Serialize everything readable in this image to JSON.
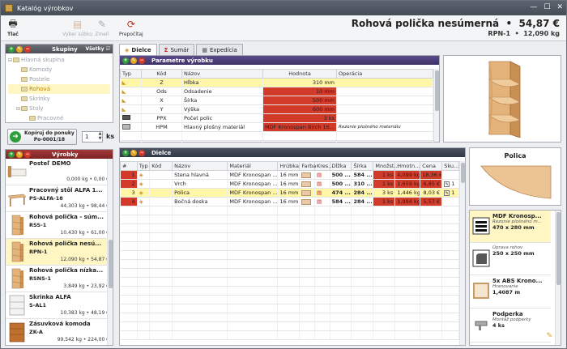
{
  "window": {
    "title": "Katalóg výrobkov"
  },
  "toolbar": {
    "print": "Tlač",
    "choose": "Výber súbku",
    "edit": "Zmeň",
    "recalc": "Prepočítaj"
  },
  "product": {
    "title": "Rohová polička nesúmerná",
    "price": "54,87 €",
    "code": "RPN-1",
    "weight": "12,090 kg"
  },
  "groups": {
    "header": "Skupiny",
    "all_label": "Všetky",
    "items": [
      {
        "label": "Hlavná skupina",
        "level": 0
      },
      {
        "label": "Komody",
        "level": 1
      },
      {
        "label": "Postele",
        "level": 1
      },
      {
        "label": "Rohová",
        "level": 1,
        "selected": true
      },
      {
        "label": "Skrinky",
        "level": 1
      },
      {
        "label": "Stoly",
        "level": 1
      },
      {
        "label": "Pracovné",
        "level": 2
      }
    ]
  },
  "copy": {
    "button_line1": "Kopíruj do ponuky",
    "button_line2": "Po-0001/18",
    "qty": "1",
    "unit": "ks"
  },
  "products": {
    "header": "Výrobky",
    "items": [
      {
        "name": "Posteľ DEMO",
        "code": "",
        "info": "0,000 kg • 0,00 €"
      },
      {
        "name": "Pracovný stôl ALFA 1...",
        "code": "PS-ALFA-18",
        "info": "44,303 kg • 98,44 €"
      },
      {
        "name": "Rohová polička - súm...",
        "code": "RSS-1",
        "info": "10,430 kg • 61,00 €"
      },
      {
        "name": "Rohová polička nesú...",
        "code": "RPN-1",
        "info": "12,090 kg • 54,87 €",
        "selected": true
      },
      {
        "name": "Rohová polička nízka...",
        "code": "RSNS-1",
        "info": "3,849 kg • 23,92 €"
      },
      {
        "name": "Skrinka ALFA",
        "code": "S-AL1",
        "info": "10,383 kg • 48,19 €"
      },
      {
        "name": "Zásuvková komoda",
        "code": "ZK-A",
        "info": "99,542 kg • 224,00 €"
      }
    ]
  },
  "tabs": [
    {
      "label": "Dielce",
      "active": true
    },
    {
      "label": "Sumár"
    },
    {
      "label": "Expedícia"
    }
  ],
  "params": {
    "header": "Parametre výrobku",
    "columns": [
      "Typ",
      "Kód",
      "Názov",
      "Hodnota",
      "Operácia"
    ],
    "rows": [
      {
        "code": "Z",
        "name": "Hĺbka",
        "value": "310 mm",
        "op": "",
        "hl": true
      },
      {
        "code": "Ods",
        "name": "Odsadenie",
        "value": "10 mm",
        "op": ""
      },
      {
        "code": "X",
        "name": "Šírka",
        "value": "500 mm",
        "op": ""
      },
      {
        "code": "Y",
        "name": "Výška",
        "value": "600 mm",
        "op": ""
      },
      {
        "code": "PPX",
        "name": "Počet polic",
        "value": "3 ks",
        "op": ""
      },
      {
        "code": "HPM",
        "name": "Hlavný plošný materiál",
        "value": "MDF Kronospan Birch 16...",
        "op": "Rezonie plošného materiálu"
      }
    ]
  },
  "parts": {
    "header": "Dielce",
    "columns": [
      "#",
      "Typ",
      "Kód",
      "Názov",
      "Materiál",
      "Hrúbka",
      "Farba",
      "Kres...",
      "Dĺžka",
      "Šírka",
      "Množst...",
      "Hmotn...",
      "Cena",
      "Sku..."
    ],
    "rows": [
      {
        "n": "1",
        "name": "Stena hlavná",
        "mat": "MDF Kronospan ...",
        "thick": "16 mm",
        "len": "500 ...",
        "wid": "584 ...",
        "qty": "1 ks",
        "wt": "4,099 kg",
        "price": "18,36 €",
        "grp": ""
      },
      {
        "n": "2",
        "name": "Vrch",
        "mat": "MDF Kronospan ...",
        "thick": "16 mm",
        "len": "500 ...",
        "wid": "310 ...",
        "qty": "1 ks",
        "wt": "1,659 kg",
        "price": "6,85 €",
        "grp": "1"
      },
      {
        "n": "3",
        "name": "Polica",
        "mat": "MDF Kronospan ...",
        "thick": "16 mm",
        "len": "474 ...",
        "wid": "284 ...",
        "qty": "3 ks",
        "wt": "1,446 kg",
        "price": "8,03 €",
        "grp": "1",
        "hl": true
      },
      {
        "n": "4",
        "name": "Bočná doska",
        "mat": "MDF Kronospan ...",
        "thick": "16 mm",
        "len": "584 ...",
        "wid": "284 ...",
        "qty": "1 ks",
        "wt": "1,994 kg",
        "price": "5,57 €",
        "grp": ""
      }
    ]
  },
  "part_preview": {
    "title": "Polica"
  },
  "operations": [
    {
      "name": "MDF Kronosp...",
      "sub": "Rezonie plošného m...",
      "value": "470 x 280 mm"
    },
    {
      "name": "",
      "sub": "Úprava rohov",
      "value": "250 x 250 mm"
    },
    {
      "name": "5x ABS Krono...",
      "sub": "Hranovanie",
      "value": "1,4087 m"
    },
    {
      "name": "Podperka",
      "sub": "Montáž podperky",
      "value": "4 ks"
    }
  ]
}
